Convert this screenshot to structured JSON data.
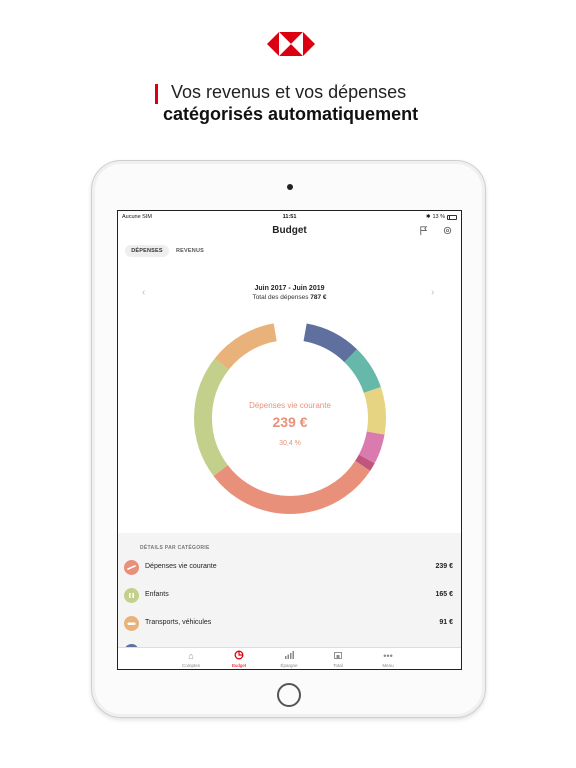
{
  "headline": {
    "line1": "Vos revenus et vos dépenses",
    "line2": "catégorisés automatiquement"
  },
  "status_bar": {
    "carrier": "Aucune SIM",
    "time": "11:51",
    "battery": "13 %"
  },
  "nav": {
    "title": "Budget",
    "icons": [
      "flag-icon",
      "gear-icon"
    ]
  },
  "segments": [
    {
      "label": "DÉPENSES",
      "active": true
    },
    {
      "label": "REVENUS",
      "active": false
    }
  ],
  "summary": {
    "period": "Juin 2017 - Juin 2019",
    "total_label": "Total des dépenses",
    "total_value": "787 €"
  },
  "donut_center": {
    "label": "Dépenses vie courante",
    "value": "239 €",
    "percent": "30,4 %"
  },
  "donut_segments": [
    {
      "color": "#5f6f9e",
      "share": 0.095
    },
    {
      "color": "#66b8aa",
      "share": 0.075
    },
    {
      "color": "#e7d482",
      "share": 0.08
    },
    {
      "color": "#d97bae",
      "share": 0.05
    },
    {
      "color": "#c0567d",
      "share": 0.015
    },
    {
      "color": "#e8907a",
      "share": 0.304
    },
    {
      "color": "#c2d08c",
      "share": 0.21
    },
    {
      "color": "#e9b27b",
      "share": 0.116
    }
  ],
  "categories_header": "DÉTAILS PAR CATÉGORIE",
  "categories": [
    {
      "name": "Dépenses vie courante",
      "amount": "239 €",
      "color": "#e8907a",
      "icon": "cart-icon"
    },
    {
      "name": "Enfants",
      "amount": "165 €",
      "color": "#c2d08c",
      "icon": "child-icon"
    },
    {
      "name": "Transports, véhicules",
      "amount": "91 €",
      "color": "#e9b27b",
      "icon": "car-icon"
    }
  ],
  "tabs": [
    {
      "label": "Comptes",
      "icon": "home-icon",
      "active": false
    },
    {
      "label": "Budget",
      "icon": "budget-icon",
      "active": true
    },
    {
      "label": "Épargne",
      "icon": "chart-icon",
      "active": false
    },
    {
      "label": "Total",
      "icon": "bank-icon",
      "active": false
    },
    {
      "label": "Menu",
      "icon": "more-icon",
      "active": false
    }
  ],
  "colors": {
    "brand_red": "#db0011",
    "accent_salmon": "#e8907a"
  }
}
